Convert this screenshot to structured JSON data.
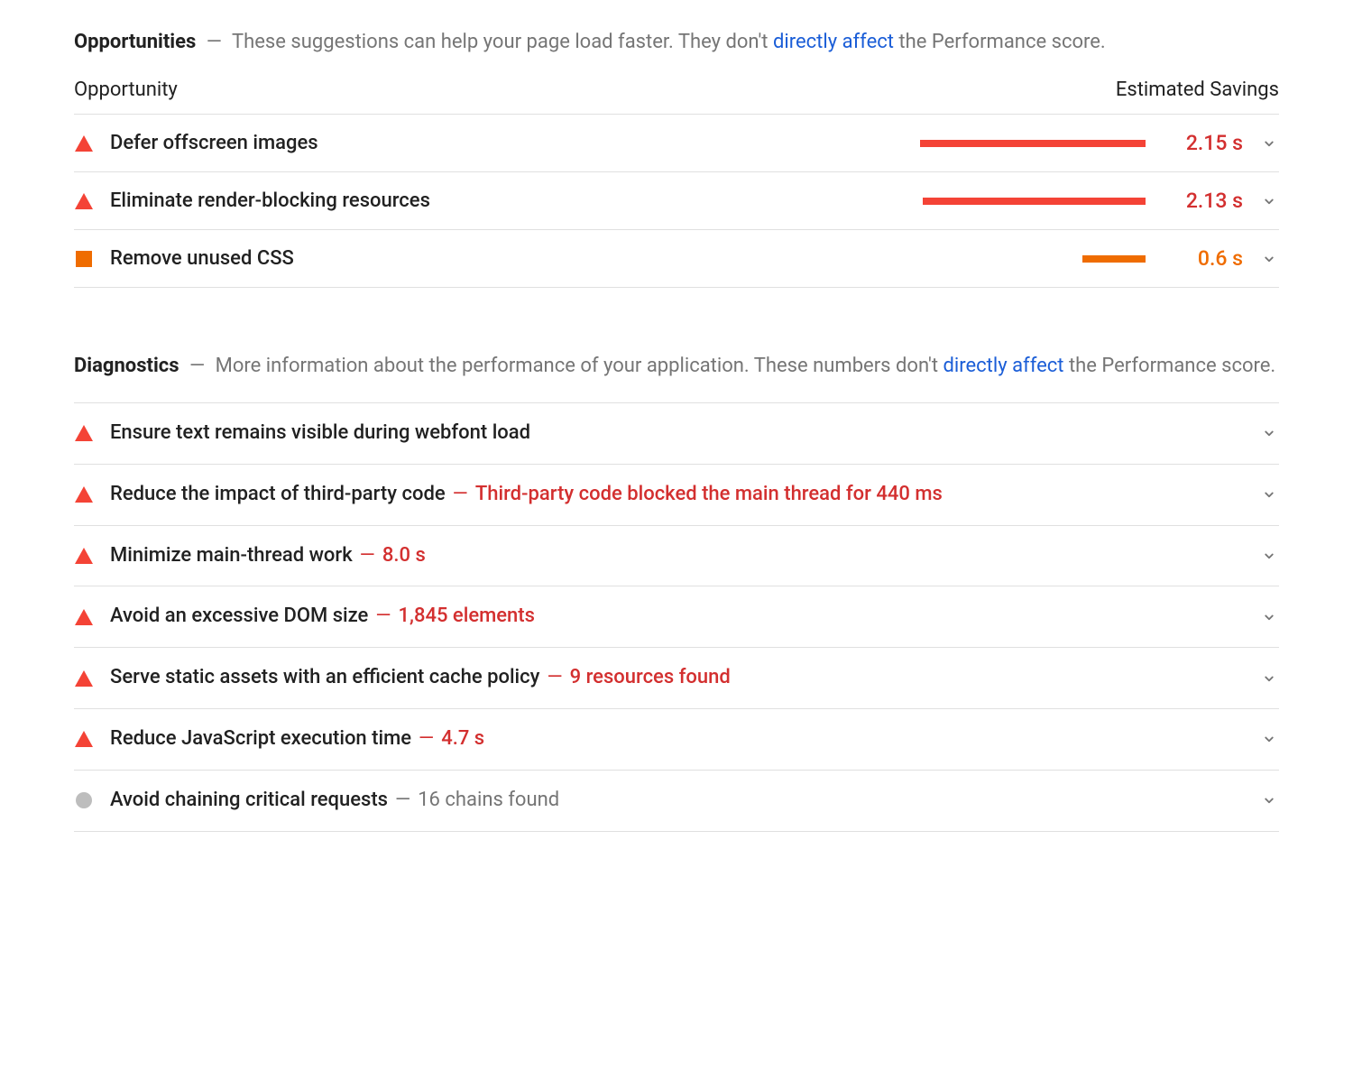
{
  "opportunities": {
    "title": "Opportunities",
    "dash": "—",
    "desc_pre": "These suggestions can help your page load faster. They don't ",
    "desc_link": "directly affect",
    "desc_post": " the Performance score.",
    "col_opportunity": "Opportunity",
    "col_savings": "Estimated Savings",
    "items": [
      {
        "severity": "triangle-red",
        "title": "Defer offscreen images",
        "bar_pct": 100,
        "bar_color": "bar-red",
        "savings": "2.15 s",
        "savings_class": "savings-red"
      },
      {
        "severity": "triangle-red",
        "title": "Eliminate render-blocking resources",
        "bar_pct": 99,
        "bar_color": "bar-red",
        "savings": "2.13 s",
        "savings_class": "savings-red"
      },
      {
        "severity": "square-orange",
        "title": "Remove unused CSS",
        "bar_pct": 28,
        "bar_color": "bar-orange",
        "savings": "0.6 s",
        "savings_class": "savings-orange"
      }
    ]
  },
  "diagnostics": {
    "title": "Diagnostics",
    "dash": "—",
    "desc_pre": "More information about the performance of your application. These numbers don't ",
    "desc_link": "directly affect",
    "desc_post": " the Performance score.",
    "items": [
      {
        "severity": "triangle-red",
        "title": "Ensure text remains visible during webfont load",
        "detail": "",
        "detail_class": ""
      },
      {
        "severity": "triangle-red",
        "title": "Reduce the impact of third-party code",
        "detail": "Third-party code blocked the main thread for 440 ms",
        "detail_class": "red"
      },
      {
        "severity": "triangle-red",
        "title": "Minimize main-thread work",
        "detail": "8.0 s",
        "detail_class": "red"
      },
      {
        "severity": "triangle-red",
        "title": "Avoid an excessive DOM size",
        "detail": "1,845 elements",
        "detail_class": "red"
      },
      {
        "severity": "triangle-red",
        "title": "Serve static assets with an efficient cache policy",
        "detail": "9 resources found",
        "detail_class": "red"
      },
      {
        "severity": "triangle-red",
        "title": "Reduce JavaScript execution time",
        "detail": "4.7 s",
        "detail_class": "red"
      },
      {
        "severity": "circle-grey",
        "title": "Avoid chaining critical requests",
        "detail": "16 chains found",
        "detail_class": "grey"
      }
    ]
  }
}
